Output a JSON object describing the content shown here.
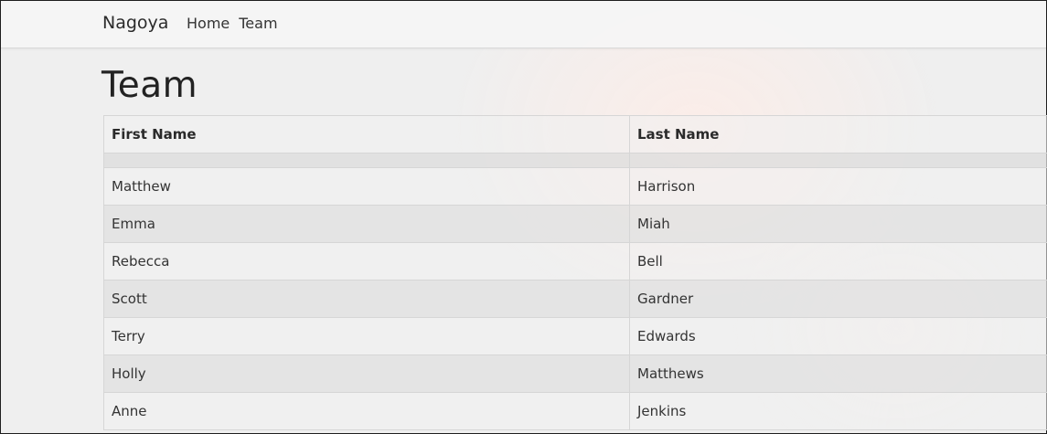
{
  "navbar": {
    "brand": "Nagoya",
    "links": [
      {
        "label": "Home"
      },
      {
        "label": "Team"
      }
    ]
  },
  "page": {
    "title": "Team"
  },
  "table": {
    "headers": [
      "First Name",
      "Last Name"
    ],
    "rows": [
      {
        "first": "Matthew",
        "last": "Harrison"
      },
      {
        "first": "Emma",
        "last": "Miah"
      },
      {
        "first": "Rebecca",
        "last": "Bell"
      },
      {
        "first": "Scott",
        "last": "Gardner"
      },
      {
        "first": "Terry",
        "last": "Edwards"
      },
      {
        "first": "Holly",
        "last": "Matthews"
      },
      {
        "first": "Anne",
        "last": "Jenkins"
      }
    ]
  }
}
